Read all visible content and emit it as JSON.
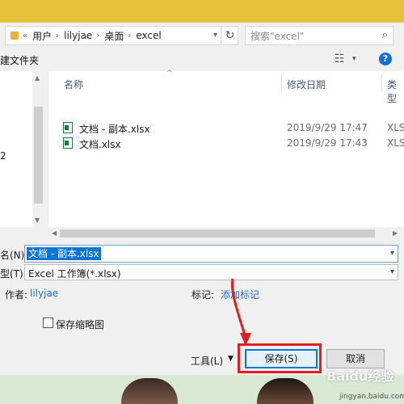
{
  "address": {
    "segments": [
      "用户",
      "lilyjae",
      "桌面",
      "excel"
    ],
    "overflow": "«",
    "sep": "›"
  },
  "search": {
    "placeholder": "搜索\"excel\""
  },
  "toolbar": {
    "new_folder": "建文件夹",
    "help": "?"
  },
  "left_pane": {
    "item": "2"
  },
  "columns": {
    "name": "名称",
    "modified": "修改日期",
    "type": "类型"
  },
  "files": [
    {
      "name": "文档 - 副本.xlsx",
      "date": "2019/9/29 17:47",
      "type": "XLS"
    },
    {
      "name": "文档.xlsx",
      "date": "2019/9/29 17:43",
      "type": "XLS"
    }
  ],
  "form": {
    "filename_label": "名(N):",
    "filename_value": "文档 - 副本.xlsx",
    "filetype_label": "型(T):",
    "filetype_value": "Excel 工作簿(*.xlsx)",
    "author_label": "作者:",
    "author_value": "lilyjae",
    "tags_label": "标记:",
    "tags_value": "添加标记",
    "thumbnail_label": "保存缩略图"
  },
  "buttons": {
    "tools": "工具(L)",
    "save": "保存(S)",
    "cancel": "取消"
  },
  "watermark": {
    "brand": "Baidu经验",
    "url": "jingyan.baidu.com"
  },
  "colors": {
    "accent": "#0078d7",
    "highlight": "#e41e1e",
    "title_bar": "#e6c23c"
  }
}
